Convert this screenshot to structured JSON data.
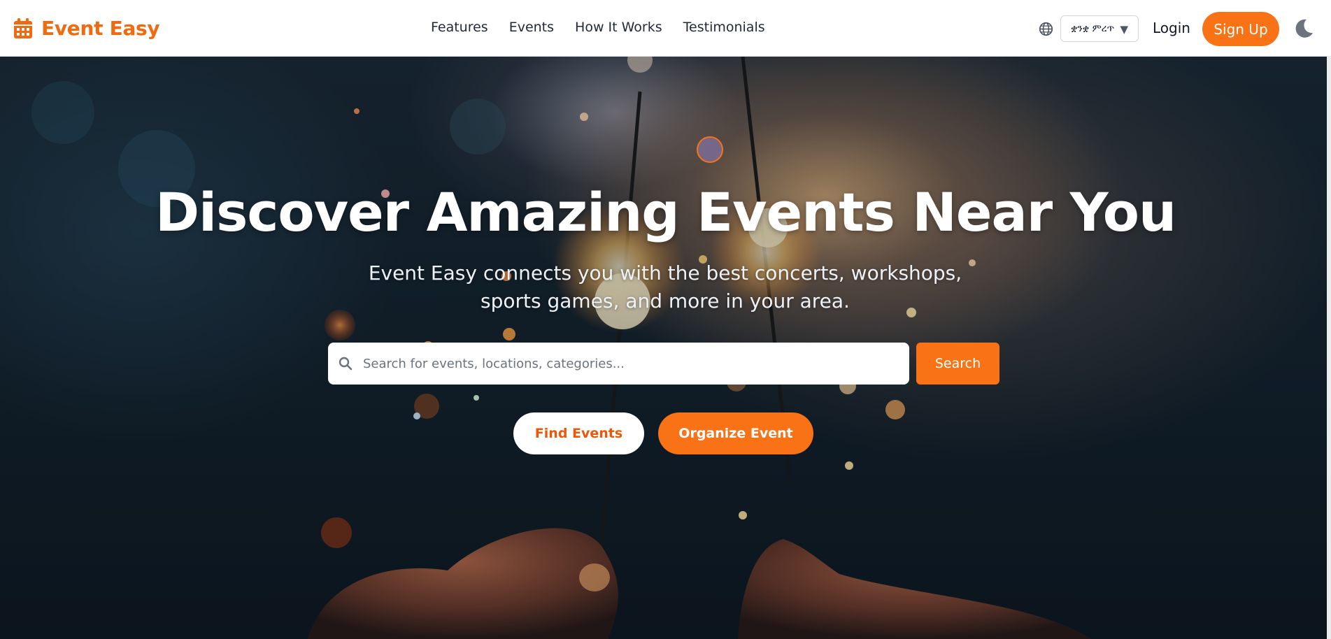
{
  "brand": {
    "name": "Event Easy",
    "icon": "calendar-icon",
    "color": "#f06a0f"
  },
  "nav": {
    "links": [
      "Features",
      "Events",
      "How It Works",
      "Testimonials"
    ]
  },
  "header": {
    "globe_icon": "globe-icon",
    "language": {
      "selected": "ቋንቋ ምረጥ"
    },
    "login_label": "Login",
    "signup_label": "Sign Up",
    "theme_icon": "moon-icon"
  },
  "hero": {
    "title": "Discover Amazing Events Near You",
    "subtitle": "Event Easy connects you with the best concerts, workshops, sports games, and more in your area.",
    "search": {
      "placeholder": "Search for events, locations, categories...",
      "value": "",
      "button_label": "Search"
    },
    "find_events_label": "Find Events",
    "organize_event_label": "Organize Event"
  },
  "colors": {
    "accent": "#f97316",
    "accent_dark": "#ea580c",
    "nav_text": "#1f2937"
  }
}
